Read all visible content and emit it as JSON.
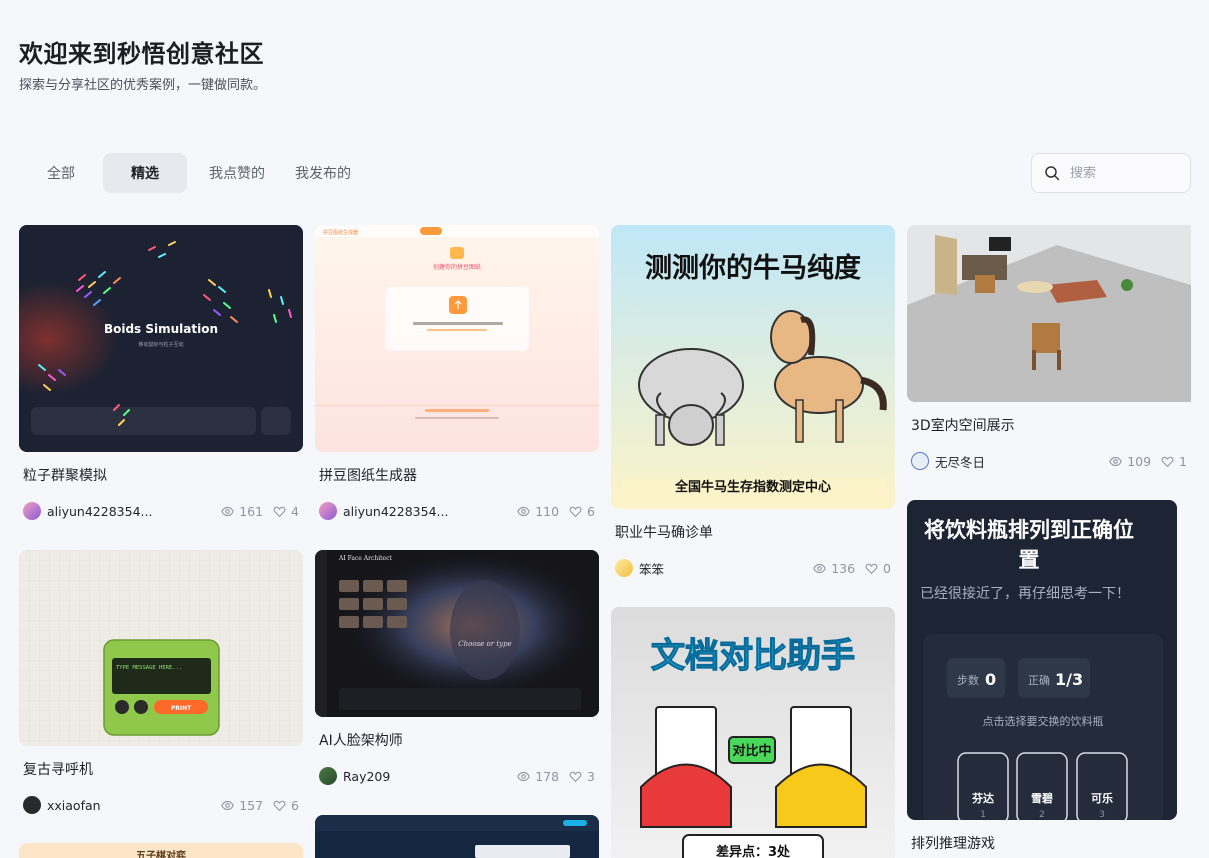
{
  "hero": {
    "title": "欢迎来到秒悟创意社区",
    "subtitle": "探索与分享社区的优秀案例，一键做同款。"
  },
  "tabs": [
    {
      "label": "全部",
      "active": false
    },
    {
      "label": "精选",
      "active": true
    },
    {
      "label": "我点赞的",
      "active": false
    },
    {
      "label": "我发布的",
      "active": false
    }
  ],
  "search": {
    "placeholder": "搜索"
  },
  "cards": [
    {
      "title": "粒子群聚模拟",
      "author": "aliyun4228354...",
      "views": "161",
      "likes": "4",
      "thumb_text": "Boids Simulation",
      "thumb_sub": "移动鼠标与粒子互动"
    },
    {
      "title": "拼豆图纸生成器",
      "author": "aliyun4228354...",
      "views": "110",
      "likes": "6",
      "thumb_text": "拼豆图纸生成器"
    },
    {
      "title": "职业牛马确诊单",
      "author": "笨笨",
      "views": "136",
      "likes": "0",
      "thumb_text": "测测你的牛马纯度",
      "thumb_sub": "全国牛马生存指数测定中心"
    },
    {
      "title": "3D室内空间展示",
      "author": "无尽冬日",
      "views": "109",
      "likes": "1"
    },
    {
      "title": "复古寻呼机",
      "author": "xxiaofan",
      "views": "157",
      "likes": "6",
      "thumb_text": "TYPE MESSAGE HERE...",
      "thumb_sub": "PRINT"
    },
    {
      "title": "AI人脸架构师",
      "author": "Ray209",
      "views": "178",
      "likes": "3",
      "thumb_text": "AI Face Architect",
      "thumb_sub": "Choose or type"
    },
    {
      "title": "",
      "author": "",
      "views": "",
      "likes": "",
      "thumb_text": "文档对比助手",
      "thumb_sub": "对比中",
      "thumb_badge": "差异点：3处"
    },
    {
      "title": "排列推理游戏",
      "author": "",
      "views": "",
      "likes": "",
      "thumb_text": "将饮料瓶排列到正确位置",
      "thumb_sub": "已经很接近了，再仔细思考一下！",
      "steps_label": "步数",
      "steps_value": "0",
      "correct_label": "正确",
      "correct_value": "1/3",
      "hint": "点击选择要交换的饮料瓶",
      "bottles": [
        "芬达",
        "雪碧",
        "可乐"
      ],
      "bottle_nums": [
        "1",
        "2",
        "3"
      ]
    },
    {
      "title": "",
      "author": "",
      "views": "",
      "likes": "",
      "thumb_text": "五子棋对弈"
    }
  ],
  "colors": {
    "accent_tab_bg": "#e8e9ee",
    "page_bg": "#f6f7fb"
  }
}
